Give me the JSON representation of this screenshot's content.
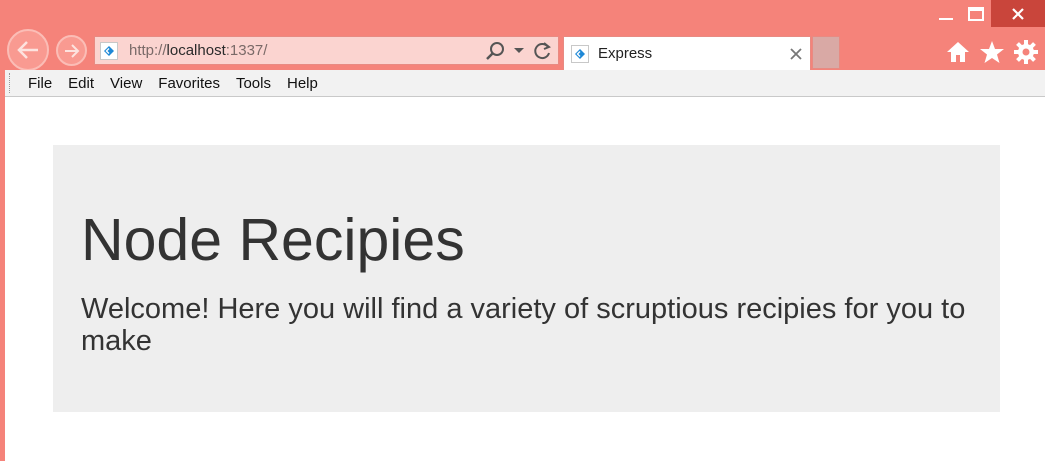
{
  "browser": {
    "address": {
      "prefix": "http://",
      "host": "localhost",
      "suffix": ":1337/"
    },
    "tab": {
      "title": "Express"
    },
    "menu": [
      "File",
      "Edit",
      "View",
      "Favorites",
      "Tools",
      "Help"
    ],
    "icons": {
      "back": "arrow-left-icon",
      "forward": "arrow-right-icon",
      "search": "search-icon",
      "dropdown": "chevron-down-icon",
      "refresh": "refresh-icon",
      "home": "home-icon",
      "favorites": "star-icon",
      "tools": "gear-icon"
    },
    "colors": {
      "frame": "#f5837a",
      "close": "#c9453b",
      "favicon": "#1e88d6"
    }
  },
  "page": {
    "title": "Node Recipies",
    "lead": "Welcome! Here you will find a variety of scruptious recipies for you to make"
  }
}
